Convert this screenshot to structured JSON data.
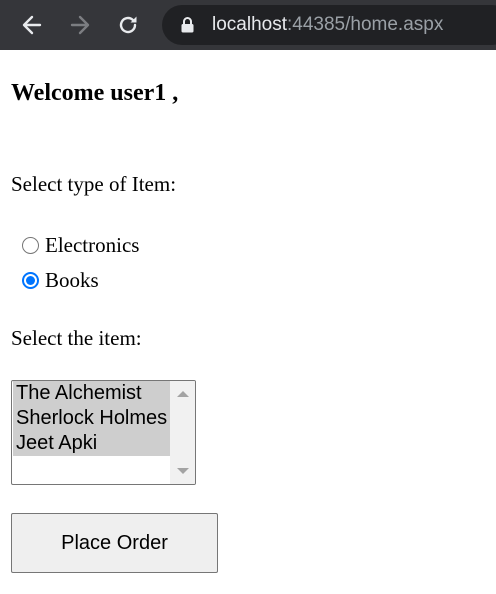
{
  "browser": {
    "url_host": "localhost",
    "url_rest": ":44385/home.aspx",
    "toolbar_color": "#35363a",
    "omnibox_color": "#202124"
  },
  "page": {
    "welcome": "Welcome user1 ,",
    "type_label": "Select type of Item:",
    "radio_options": [
      {
        "label": "Electronics",
        "checked": false
      },
      {
        "label": "Books",
        "checked": true
      }
    ],
    "item_label": "Select the item:",
    "items": [
      "The Alchemist",
      "Sherlock Holmes",
      "Jeet Apki"
    ],
    "button_label": "Place Order",
    "radio_accent": "#0075ff"
  }
}
